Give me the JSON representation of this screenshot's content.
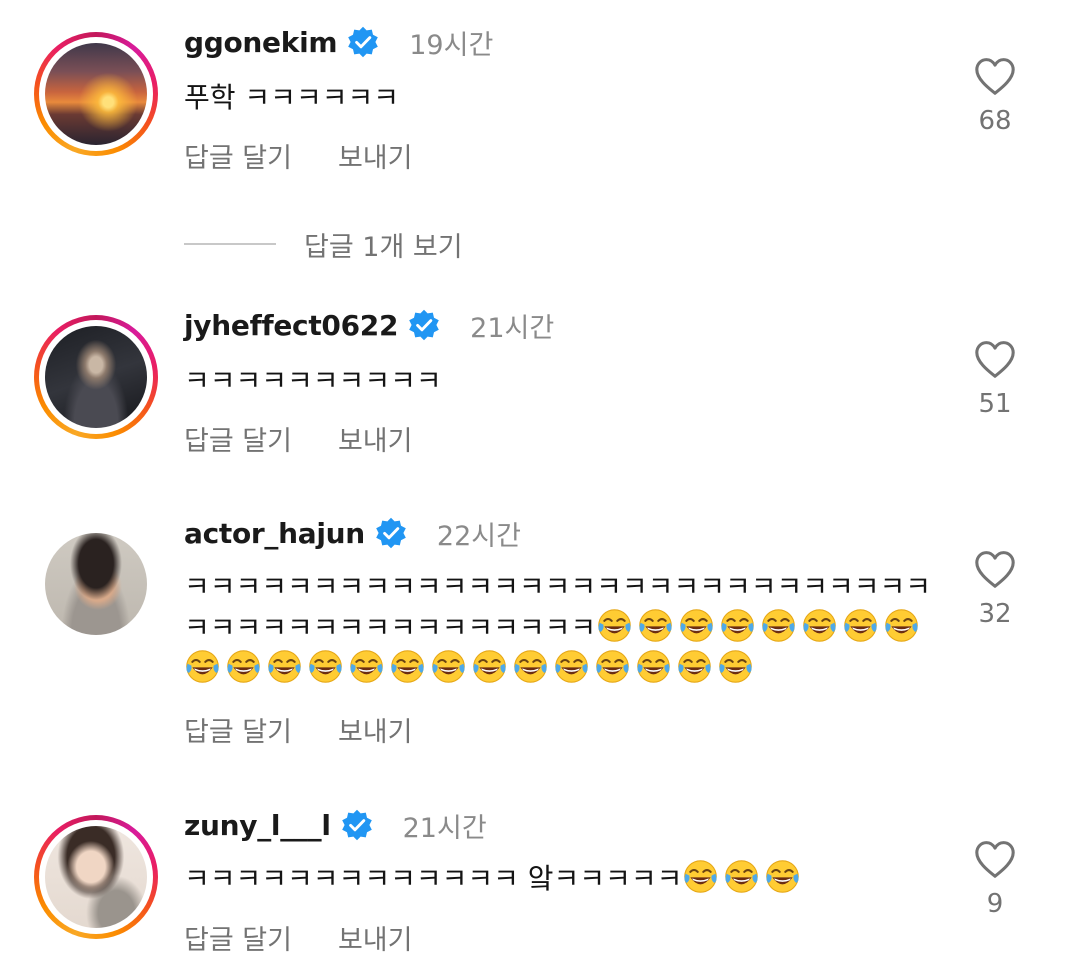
{
  "colors": {
    "verified": "#2196f3",
    "secondary_text": "#737373",
    "story_ring": [
      "#f9a825",
      "#e91e63"
    ]
  },
  "icons": {
    "verified": "verified-badge-icon",
    "like": "heart-outline-icon",
    "emoji": "face-with-tears-of-joy-emoji"
  },
  "comments": [
    {
      "username": "ggonekim",
      "verified": true,
      "time": "19시간",
      "text": "푸학 ㅋㅋㅋㅋㅋㅋ",
      "emoji_count": 0,
      "reply_label": "답글 달기",
      "send_label": "보내기",
      "likes": "68",
      "has_story_ring": true
    },
    {
      "username": "jyheffect0622",
      "verified": true,
      "time": "21시간",
      "text": "ㅋㅋㅋㅋㅋㅋㅋㅋㅋㅋ",
      "emoji_count": 0,
      "reply_label": "답글 달기",
      "send_label": "보내기",
      "likes": "51",
      "has_story_ring": true
    },
    {
      "username": "actor_hajun",
      "verified": true,
      "time": "22시간",
      "text": "ㅋㅋㅋㅋㅋㅋㅋㅋㅋㅋㅋㅋㅋㅋㅋㅋㅋㅋㅋㅋㅋㅋㅋㅋㅋㅋㅋㅋㅋㅋㅋㅋㅋㅋㅋㅋㅋㅋㅋㅋㅋㅋㅋㅋㅋ",
      "emoji_count": 22,
      "reply_label": "답글 달기",
      "send_label": "보내기",
      "likes": "32",
      "has_story_ring": false
    },
    {
      "username": "zuny_l___l",
      "verified": true,
      "time": "21시간",
      "text": "ㅋㅋㅋㅋㅋㅋㅋㅋㅋㅋㅋㅋㅋ 앜ㅋㅋㅋㅋㅋ",
      "emoji_count": 3,
      "reply_label": "답글 달기",
      "send_label": "보내기",
      "likes": "9",
      "has_story_ring": true
    }
  ],
  "view_replies": "답글 1개 보기"
}
